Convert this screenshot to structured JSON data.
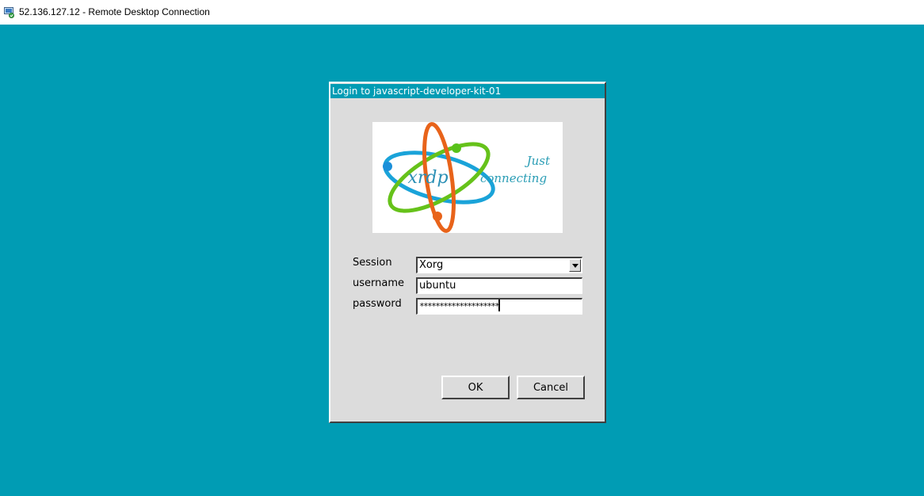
{
  "window": {
    "title": "52.136.127.12 - Remote Desktop Connection",
    "icon": "remote-desktop-icon"
  },
  "dialog": {
    "title": "Login to javascript-developer-kit-01",
    "logo": {
      "brand": "xrdp",
      "tagline_line1": "Just",
      "tagline_line2": "connecting"
    },
    "fields": {
      "session_label": "Session",
      "session_value": "Xorg",
      "username_label": "username",
      "username_value": "ubuntu",
      "password_label": "password",
      "password_value": "********************"
    },
    "buttons": {
      "ok": "OK",
      "cancel": "Cancel"
    }
  },
  "colors": {
    "desktop": "#009cb4",
    "dialog_bg": "#dcdcdc",
    "title_bg": "#009cb4"
  }
}
